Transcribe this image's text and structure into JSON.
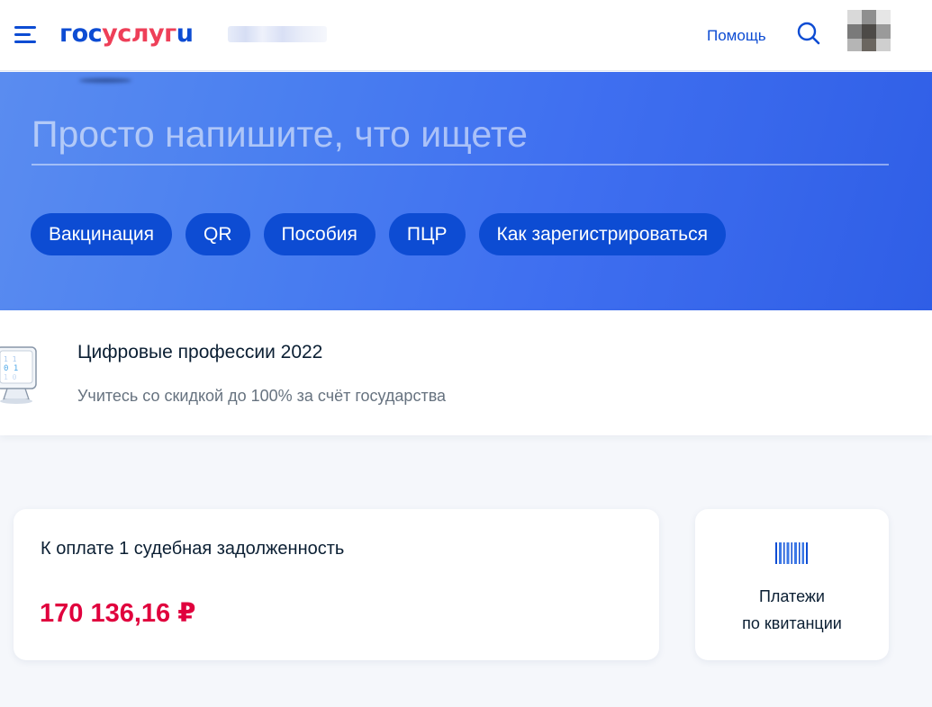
{
  "header": {
    "logo": {
      "part1": "гос",
      "part2": "услуг",
      "part3": "u"
    },
    "help_label": "Помощь",
    "icons": {
      "menu": "menu-icon",
      "search": "search-icon",
      "avatar": "user-avatar"
    }
  },
  "hero": {
    "search_placeholder": "Просто напишите, что ищете",
    "chips": [
      "Вакцинация",
      "QR",
      "Пособия",
      "ПЦР",
      "Как зарегистрироваться"
    ]
  },
  "banner": {
    "title": "Цифровые профессии 2022",
    "subtitle": "Учитесь со скидкой до 100% за счёт государства",
    "icon": "computer-monitor-icon"
  },
  "debt_card": {
    "title": "К оплате 1 судебная задолженность",
    "amount": "170 136,16 ₽"
  },
  "pay_card": {
    "line1": "Платежи",
    "line2": "по квитанции",
    "icon": "barcode-icon"
  },
  "colors": {
    "brand_blue": "#0d4cd3",
    "brand_red": "#ee3f58",
    "amount_red": "#e0003d",
    "hero_gradient_start": "#5a8cf0",
    "hero_gradient_end": "#2f5ee6"
  }
}
